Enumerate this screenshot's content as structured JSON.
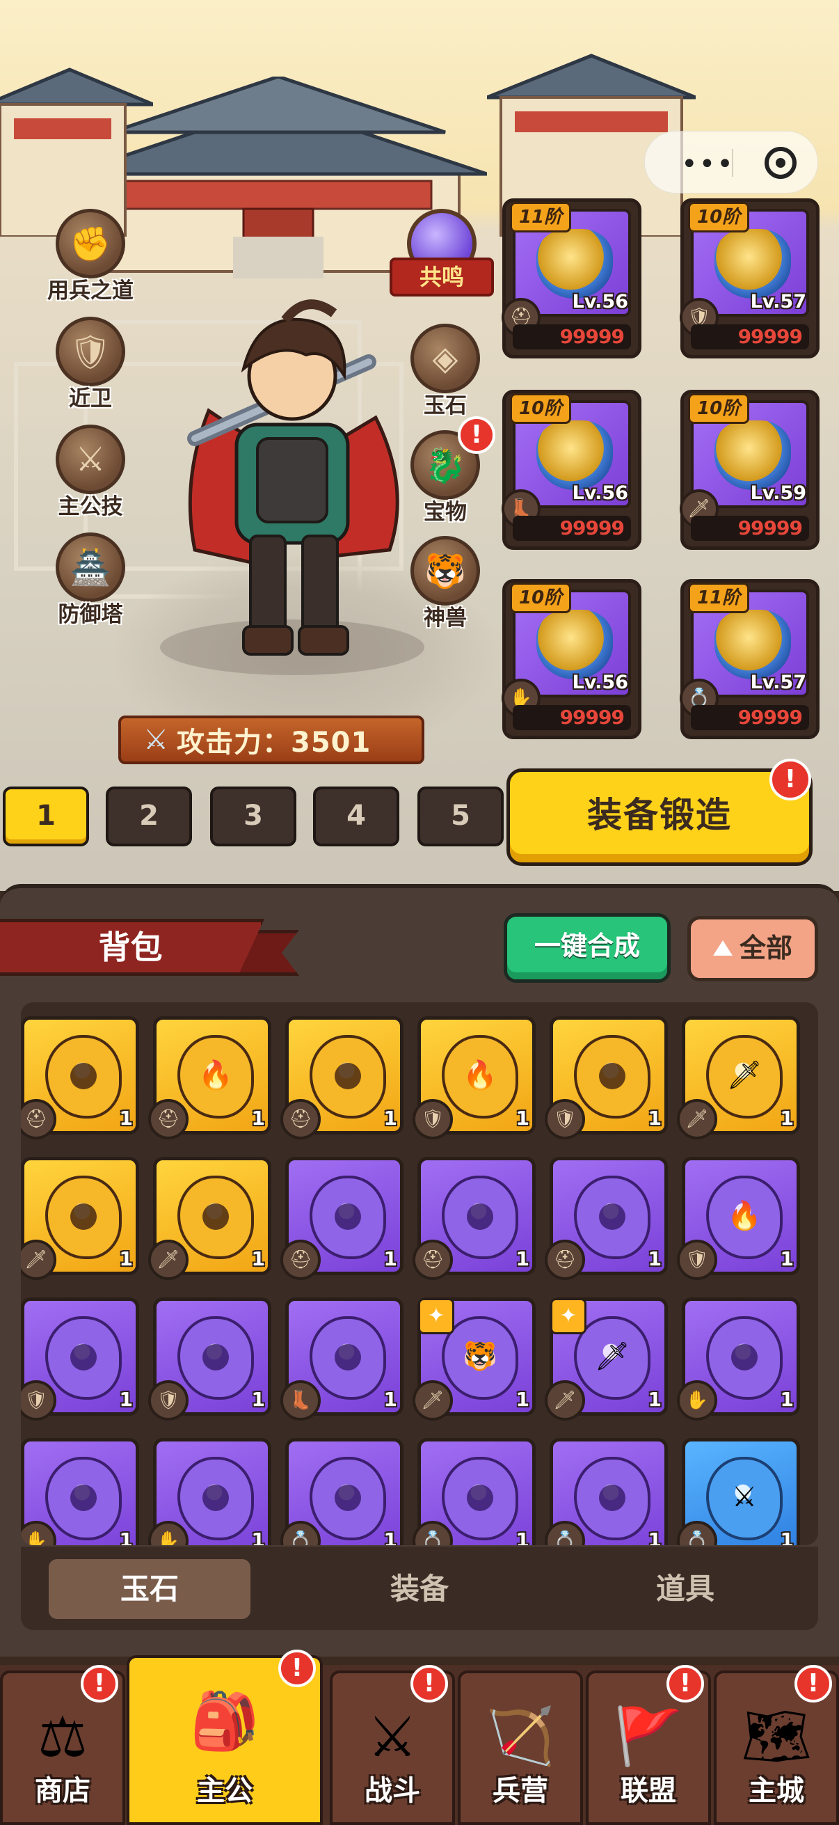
{
  "side_menu_left": [
    {
      "label": "用兵之道",
      "icon": "strategy-icon"
    },
    {
      "label": "近卫",
      "icon": "guard-icon"
    },
    {
      "label": "主公技",
      "icon": "lord-skill-icon"
    },
    {
      "label": "防御塔",
      "icon": "tower-icon"
    }
  ],
  "side_menu_right": [
    {
      "label": "共鸣",
      "icon": "resonance-gem-icon"
    },
    {
      "label": "玉石",
      "icon": "jade-icon"
    },
    {
      "label": "宝物",
      "icon": "treasure-icon",
      "alert": "!"
    },
    {
      "label": "神兽",
      "icon": "beast-icon"
    }
  ],
  "attack": {
    "label": "攻击力：3501"
  },
  "equipment": [
    {
      "tier": "11阶",
      "level": "Lv.56",
      "score": "99999",
      "slot_icon": "helmet-icon"
    },
    {
      "tier": "10阶",
      "level": "Lv.57",
      "score": "99999",
      "slot_icon": "armor-icon"
    },
    {
      "tier": "10阶",
      "level": "Lv.56",
      "score": "99999",
      "slot_icon": "boots-icon"
    },
    {
      "tier": "10阶",
      "level": "Lv.59",
      "score": "99999",
      "slot_icon": "weapon-icon"
    },
    {
      "tier": "10阶",
      "level": "Lv.56",
      "score": "99999",
      "slot_icon": "bracer-icon"
    },
    {
      "tier": "11阶",
      "level": "Lv.57",
      "score": "99999",
      "slot_icon": "ring-icon"
    }
  ],
  "loadouts": [
    "1",
    "2",
    "3",
    "4",
    "5"
  ],
  "active_loadout": "1",
  "forge_button": "装备锻造",
  "forge_alert": "!",
  "backpack": {
    "title": "背包",
    "merge_button": "一键合成",
    "filter_button": "全部",
    "items": [
      {
        "color": "gold",
        "sym": "",
        "slot": "⛑",
        "count": "1"
      },
      {
        "color": "gold",
        "sym": "🔥",
        "slot": "⛑",
        "count": "1"
      },
      {
        "color": "gold",
        "sym": "",
        "slot": "⛑",
        "count": "1"
      },
      {
        "color": "gold",
        "sym": "🔥",
        "slot": "🛡",
        "count": "1"
      },
      {
        "color": "gold",
        "sym": "",
        "slot": "🛡",
        "count": "1"
      },
      {
        "color": "gold",
        "sym": "🗡",
        "slot": "🗡",
        "count": "1"
      },
      {
        "color": "gold",
        "sym": "",
        "slot": "🗡",
        "count": "1"
      },
      {
        "color": "gold",
        "sym": "",
        "slot": "🗡",
        "count": "1"
      },
      {
        "color": "purple",
        "sym": "",
        "slot": "⛑",
        "count": "1"
      },
      {
        "color": "purple",
        "sym": "",
        "slot": "⛑",
        "count": "1"
      },
      {
        "color": "purple",
        "sym": "",
        "slot": "⛑",
        "count": "1"
      },
      {
        "color": "purple",
        "sym": "🔥",
        "slot": "🛡",
        "count": "1"
      },
      {
        "color": "purple",
        "sym": "",
        "slot": "🛡",
        "count": "1"
      },
      {
        "color": "purple",
        "sym": "",
        "slot": "🛡",
        "count": "1"
      },
      {
        "color": "purple",
        "sym": "",
        "slot": "👢",
        "count": "1"
      },
      {
        "color": "purple",
        "sym": "🐯",
        "slot": "🗡",
        "count": "1",
        "star": "✦"
      },
      {
        "color": "purple",
        "sym": "🗡",
        "slot": "🗡",
        "count": "1",
        "star": "✦"
      },
      {
        "color": "purple",
        "sym": "",
        "slot": "✋",
        "count": "1"
      },
      {
        "color": "purple",
        "sym": "",
        "slot": "✋",
        "count": "1"
      },
      {
        "color": "purple",
        "sym": "",
        "slot": "✋",
        "count": "1"
      },
      {
        "color": "purple",
        "sym": "",
        "slot": "💍",
        "count": "1"
      },
      {
        "color": "purple",
        "sym": "",
        "slot": "💍",
        "count": "1"
      },
      {
        "color": "purple",
        "sym": "",
        "slot": "💍",
        "count": "1"
      },
      {
        "color": "blue",
        "sym": "⚔",
        "slot": "💍",
        "count": "1"
      }
    ]
  },
  "subtabs": [
    "玉石",
    "装备",
    "道具"
  ],
  "active_subtab": "玉石",
  "bottom_nav": [
    {
      "label": "商店",
      "icon": "shop-icon",
      "glyph": "⚖",
      "alert": "!"
    },
    {
      "label": "主公",
      "icon": "lord-icon",
      "glyph": "🎒",
      "alert": "!"
    },
    {
      "label": "战斗",
      "icon": "battle-icon",
      "glyph": "⚔",
      "alert": "!"
    },
    {
      "label": "兵营",
      "icon": "barracks-icon",
      "glyph": "🏹",
      "alert": ""
    },
    {
      "label": "联盟",
      "icon": "alliance-icon",
      "glyph": "🚩",
      "alert": "!"
    },
    {
      "label": "主城",
      "icon": "city-icon",
      "glyph": "🗺",
      "alert": "!"
    }
  ],
  "colors": {
    "accent_yellow": "#ffd21a",
    "panel_brown": "#4b3d35",
    "merge_green": "#27c47a",
    "alert_red": "#e8352c"
  }
}
